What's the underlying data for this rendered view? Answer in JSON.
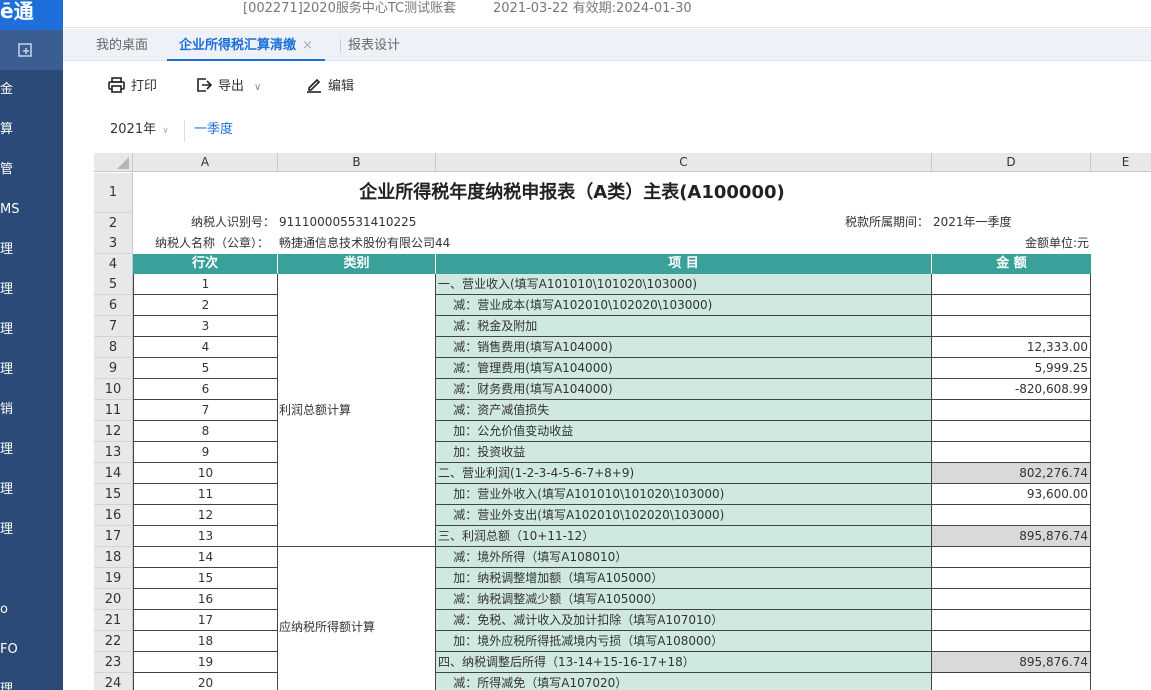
{
  "app": {
    "logo": "ē通",
    "account_text": "[002271]2020服务中心TC测试账套",
    "date_text": "2021-03-22   有效期:2024-01-30",
    "sidebar_items": [
      "金",
      "算",
      "管",
      "MS",
      "理",
      "理",
      "理",
      "理",
      "销",
      "理",
      "理",
      "理",
      "",
      "o",
      "FO",
      "理"
    ]
  },
  "tabs": [
    {
      "label": "我的桌面",
      "active": false
    },
    {
      "label": "企业所得税汇算清缴",
      "active": true,
      "close": "×"
    },
    {
      "label": "报表设计",
      "active": false
    }
  ],
  "toolbar": {
    "print_label": "打印",
    "export_label": "导出",
    "export_caret": "∨",
    "edit_label": "编辑"
  },
  "filter": {
    "year": "2021年",
    "year_caret": "∨",
    "period": "一季度"
  },
  "sheet": {
    "col_letters": [
      "A",
      "B",
      "C",
      "D",
      "E"
    ],
    "title": "企业所得税年度纳税申报表（A类）主表(A100000)",
    "taxpayer_id_label": "纳税人识别号：",
    "taxpayer_id": "91110000553141022​5",
    "tax_period_label": "税款所属期间：",
    "tax_period": "2021年一季度",
    "taxpayer_name_label": "纳税人名称（公章）：",
    "taxpayer_name": "畅捷通信息技术股份有限公司44",
    "unit": "金额单位:元",
    "headers": [
      "行次",
      "类别",
      "项 目",
      "金 额"
    ],
    "categories": [
      "利润总额计算",
      "应纳税所得额计算"
    ],
    "rows": [
      {
        "row": "5",
        "seq": "1",
        "item": "一、营业收入(填写A101010\\101020\\103000)",
        "amount": "",
        "grey": false
      },
      {
        "row": "6",
        "seq": "2",
        "item": "    减：营业成本(填写A102010\\102020\\103000)",
        "amount": "",
        "grey": false
      },
      {
        "row": "7",
        "seq": "3",
        "item": "    减：税金及附加",
        "amount": "",
        "grey": false
      },
      {
        "row": "8",
        "seq": "4",
        "item": "    减：销售费用(填写A104000)",
        "amount": "12,333.00",
        "grey": false
      },
      {
        "row": "9",
        "seq": "5",
        "item": "    减：管理费用(填写A104000)",
        "amount": "5,999.25",
        "grey": false
      },
      {
        "row": "10",
        "seq": "6",
        "item": "    减：财务费用(填写A104000)",
        "amount": "-820,608.99",
        "grey": false
      },
      {
        "row": "11",
        "seq": "7",
        "item": "    减：资产减值损失",
        "amount": "",
        "grey": false
      },
      {
        "row": "12",
        "seq": "8",
        "item": "    加：公允价值变动收益",
        "amount": "",
        "grey": false
      },
      {
        "row": "13",
        "seq": "9",
        "item": "    加：投资收益",
        "amount": "",
        "grey": false
      },
      {
        "row": "14",
        "seq": "10",
        "item": "二、营业利润(1-2-3-4-5-6-7+8+9)",
        "amount": "802,276.74",
        "grey": true
      },
      {
        "row": "15",
        "seq": "11",
        "item": "    加：营业外收入(填写A101010\\101020\\103000)",
        "amount": "93,600.00",
        "grey": false
      },
      {
        "row": "16",
        "seq": "12",
        "item": "    减：营业外支出(填写A102010\\102020\\103000)",
        "amount": "",
        "grey": false
      },
      {
        "row": "17",
        "seq": "13",
        "item": "三、利润总额（10+11-12）",
        "amount": "895,876.74",
        "grey": true
      },
      {
        "row": "18",
        "seq": "14",
        "item": "    减：境外所得（填写A108010）",
        "amount": "",
        "grey": false
      },
      {
        "row": "19",
        "seq": "15",
        "item": "    加：纳税调整增加额（填写A105000）",
        "amount": "",
        "grey": false
      },
      {
        "row": "20",
        "seq": "16",
        "item": "    减：纳税调整减少额（填写A105000）",
        "amount": "",
        "grey": false
      },
      {
        "row": "21",
        "seq": "17",
        "item": "    减：免税、减计收入及加计扣除（填写A107010）",
        "amount": "",
        "grey": false
      },
      {
        "row": "22",
        "seq": "18",
        "item": "    加：境外应税所得抵减境内亏损（填写A108000）",
        "amount": "",
        "grey": false
      },
      {
        "row": "23",
        "seq": "19",
        "item": "四、纳税调整后所得（13-14+15-16-17+18）",
        "amount": "895,876.74",
        "grey": true
      },
      {
        "row": "24",
        "seq": "20",
        "item": "    减：所得减免（填写A107020）",
        "amount": "",
        "grey": false
      }
    ]
  }
}
